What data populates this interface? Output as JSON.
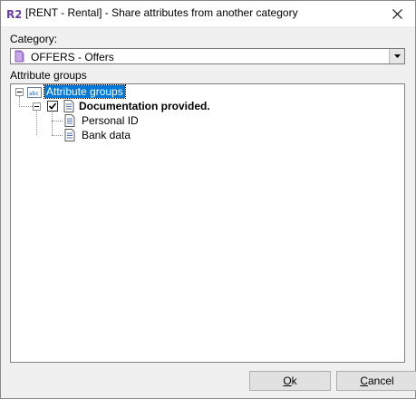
{
  "window": {
    "title": "[RENT - Rental] - Share attributes from another category",
    "app_icon": "r2-logo-icon",
    "close_icon": "close-icon"
  },
  "category": {
    "label": "Category:",
    "selected": "OFFERS - Offers",
    "icon": "folder-purple-icon"
  },
  "attribute_groups": {
    "label": "Attribute groups",
    "tree": {
      "root": {
        "label": "Attribute groups",
        "icon": "abc-group-icon",
        "selected": true,
        "expanded": true
      },
      "group": {
        "label": "Documentation provided.",
        "icon": "document-icon",
        "checked": true,
        "expanded": true
      },
      "items": [
        {
          "label": "Personal ID",
          "icon": "document-icon"
        },
        {
          "label": "Bank data",
          "icon": "document-icon"
        }
      ]
    }
  },
  "buttons": {
    "ok": {
      "accel": "O",
      "rest": "k"
    },
    "cancel": {
      "accel": "C",
      "rest": "ancel"
    }
  }
}
